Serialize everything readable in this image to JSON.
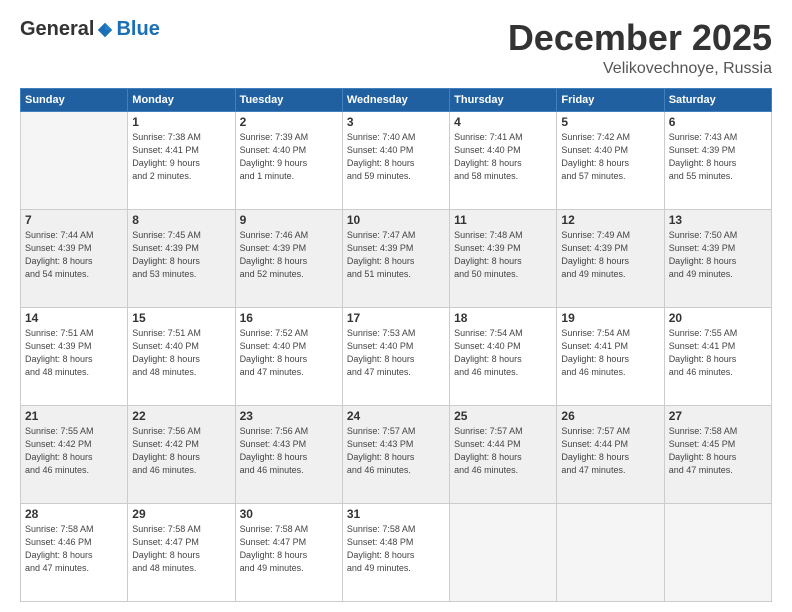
{
  "header": {
    "logo": {
      "general": "General",
      "blue": "Blue"
    },
    "title": "December 2025",
    "location": "Velikovechnoye, Russia"
  },
  "days_of_week": [
    "Sunday",
    "Monday",
    "Tuesday",
    "Wednesday",
    "Thursday",
    "Friday",
    "Saturday"
  ],
  "weeks": [
    [
      {
        "day": "",
        "info": ""
      },
      {
        "day": "1",
        "info": "Sunrise: 7:38 AM\nSunset: 4:41 PM\nDaylight: 9 hours\nand 2 minutes."
      },
      {
        "day": "2",
        "info": "Sunrise: 7:39 AM\nSunset: 4:40 PM\nDaylight: 9 hours\nand 1 minute."
      },
      {
        "day": "3",
        "info": "Sunrise: 7:40 AM\nSunset: 4:40 PM\nDaylight: 8 hours\nand 59 minutes."
      },
      {
        "day": "4",
        "info": "Sunrise: 7:41 AM\nSunset: 4:40 PM\nDaylight: 8 hours\nand 58 minutes."
      },
      {
        "day": "5",
        "info": "Sunrise: 7:42 AM\nSunset: 4:40 PM\nDaylight: 8 hours\nand 57 minutes."
      },
      {
        "day": "6",
        "info": "Sunrise: 7:43 AM\nSunset: 4:39 PM\nDaylight: 8 hours\nand 55 minutes."
      }
    ],
    [
      {
        "day": "7",
        "info": "Sunrise: 7:44 AM\nSunset: 4:39 PM\nDaylight: 8 hours\nand 54 minutes."
      },
      {
        "day": "8",
        "info": "Sunrise: 7:45 AM\nSunset: 4:39 PM\nDaylight: 8 hours\nand 53 minutes."
      },
      {
        "day": "9",
        "info": "Sunrise: 7:46 AM\nSunset: 4:39 PM\nDaylight: 8 hours\nand 52 minutes."
      },
      {
        "day": "10",
        "info": "Sunrise: 7:47 AM\nSunset: 4:39 PM\nDaylight: 8 hours\nand 51 minutes."
      },
      {
        "day": "11",
        "info": "Sunrise: 7:48 AM\nSunset: 4:39 PM\nDaylight: 8 hours\nand 50 minutes."
      },
      {
        "day": "12",
        "info": "Sunrise: 7:49 AM\nSunset: 4:39 PM\nDaylight: 8 hours\nand 49 minutes."
      },
      {
        "day": "13",
        "info": "Sunrise: 7:50 AM\nSunset: 4:39 PM\nDaylight: 8 hours\nand 49 minutes."
      }
    ],
    [
      {
        "day": "14",
        "info": "Sunrise: 7:51 AM\nSunset: 4:39 PM\nDaylight: 8 hours\nand 48 minutes."
      },
      {
        "day": "15",
        "info": "Sunrise: 7:51 AM\nSunset: 4:40 PM\nDaylight: 8 hours\nand 48 minutes."
      },
      {
        "day": "16",
        "info": "Sunrise: 7:52 AM\nSunset: 4:40 PM\nDaylight: 8 hours\nand 47 minutes."
      },
      {
        "day": "17",
        "info": "Sunrise: 7:53 AM\nSunset: 4:40 PM\nDaylight: 8 hours\nand 47 minutes."
      },
      {
        "day": "18",
        "info": "Sunrise: 7:54 AM\nSunset: 4:40 PM\nDaylight: 8 hours\nand 46 minutes."
      },
      {
        "day": "19",
        "info": "Sunrise: 7:54 AM\nSunset: 4:41 PM\nDaylight: 8 hours\nand 46 minutes."
      },
      {
        "day": "20",
        "info": "Sunrise: 7:55 AM\nSunset: 4:41 PM\nDaylight: 8 hours\nand 46 minutes."
      }
    ],
    [
      {
        "day": "21",
        "info": "Sunrise: 7:55 AM\nSunset: 4:42 PM\nDaylight: 8 hours\nand 46 minutes."
      },
      {
        "day": "22",
        "info": "Sunrise: 7:56 AM\nSunset: 4:42 PM\nDaylight: 8 hours\nand 46 minutes."
      },
      {
        "day": "23",
        "info": "Sunrise: 7:56 AM\nSunset: 4:43 PM\nDaylight: 8 hours\nand 46 minutes."
      },
      {
        "day": "24",
        "info": "Sunrise: 7:57 AM\nSunset: 4:43 PM\nDaylight: 8 hours\nand 46 minutes."
      },
      {
        "day": "25",
        "info": "Sunrise: 7:57 AM\nSunset: 4:44 PM\nDaylight: 8 hours\nand 46 minutes."
      },
      {
        "day": "26",
        "info": "Sunrise: 7:57 AM\nSunset: 4:44 PM\nDaylight: 8 hours\nand 47 minutes."
      },
      {
        "day": "27",
        "info": "Sunrise: 7:58 AM\nSunset: 4:45 PM\nDaylight: 8 hours\nand 47 minutes."
      }
    ],
    [
      {
        "day": "28",
        "info": "Sunrise: 7:58 AM\nSunset: 4:46 PM\nDaylight: 8 hours\nand 47 minutes."
      },
      {
        "day": "29",
        "info": "Sunrise: 7:58 AM\nSunset: 4:47 PM\nDaylight: 8 hours\nand 48 minutes."
      },
      {
        "day": "30",
        "info": "Sunrise: 7:58 AM\nSunset: 4:47 PM\nDaylight: 8 hours\nand 49 minutes."
      },
      {
        "day": "31",
        "info": "Sunrise: 7:58 AM\nSunset: 4:48 PM\nDaylight: 8 hours\nand 49 minutes."
      },
      {
        "day": "",
        "info": ""
      },
      {
        "day": "",
        "info": ""
      },
      {
        "day": "",
        "info": ""
      }
    ]
  ]
}
